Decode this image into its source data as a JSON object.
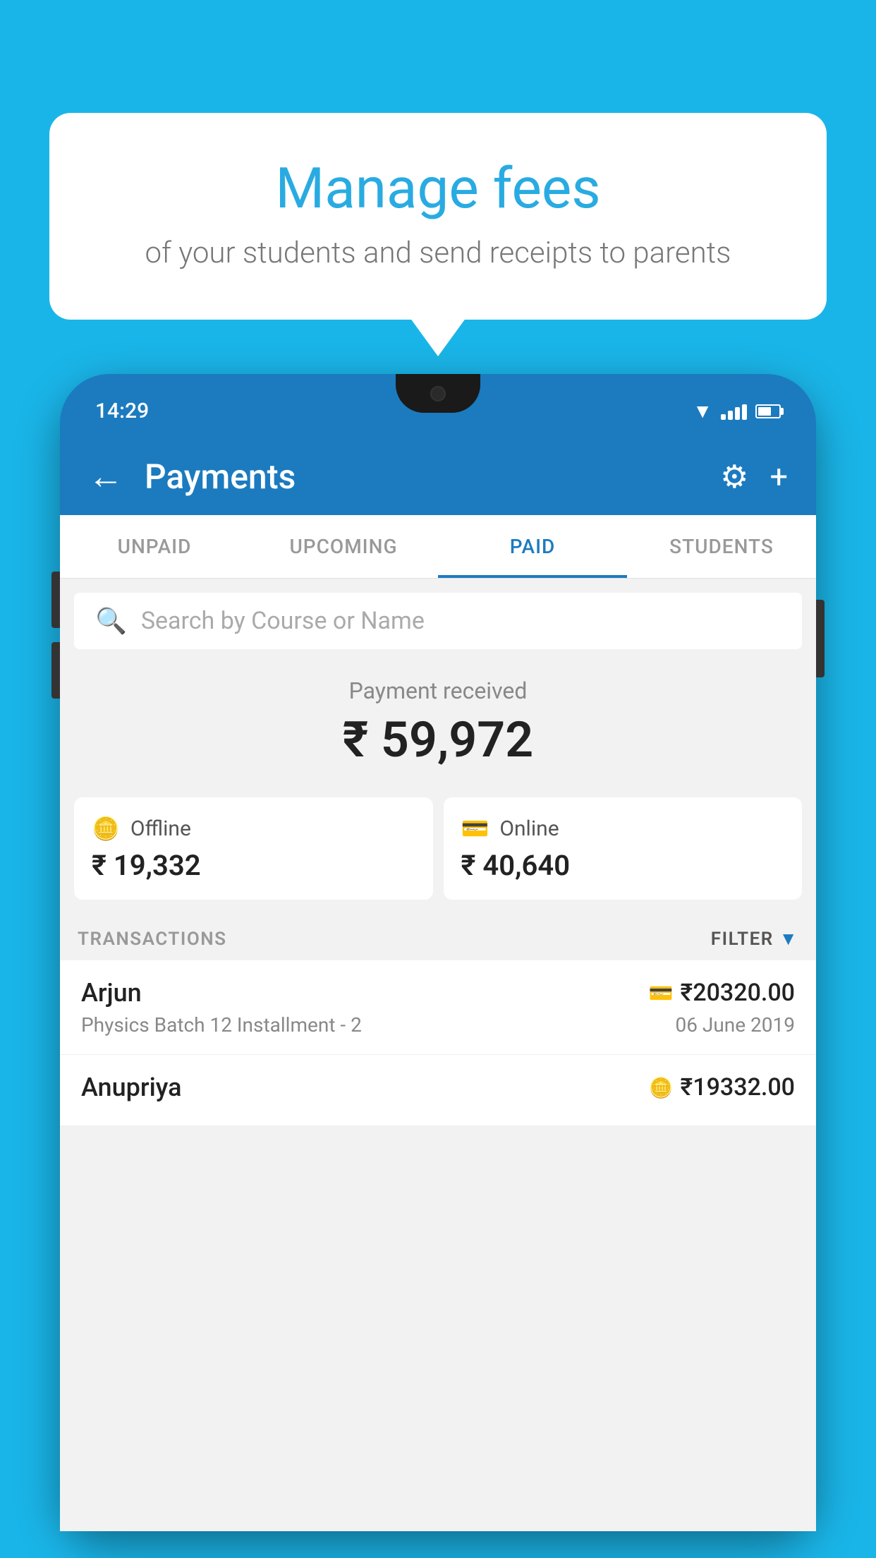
{
  "background_color": "#1ab5e8",
  "bubble": {
    "title": "Manage fees",
    "subtitle": "of your students and send receipts to parents"
  },
  "phone": {
    "status_time": "14:29",
    "header": {
      "title": "Payments",
      "back_label": "←",
      "settings_label": "⚙",
      "add_label": "+"
    },
    "tabs": [
      {
        "label": "UNPAID",
        "active": false
      },
      {
        "label": "UPCOMING",
        "active": false
      },
      {
        "label": "PAID",
        "active": true
      },
      {
        "label": "STUDENTS",
        "active": false
      }
    ],
    "search": {
      "placeholder": "Search by Course or Name"
    },
    "payment_summary": {
      "label": "Payment received",
      "amount": "₹ 59,972"
    },
    "cards": [
      {
        "icon": "💳",
        "label": "Offline",
        "amount": "₹ 19,332"
      },
      {
        "icon": "💳",
        "label": "Online",
        "amount": "₹ 40,640"
      }
    ],
    "transactions_label": "TRANSACTIONS",
    "filter_label": "FILTER",
    "transactions": [
      {
        "name": "Arjun",
        "course": "Physics Batch 12 Installment - 2",
        "amount": "₹20320.00",
        "date": "06 June 2019",
        "payment_type": "online"
      },
      {
        "name": "Anupriya",
        "course": "",
        "amount": "₹19332.00",
        "date": "",
        "payment_type": "offline"
      }
    ]
  }
}
